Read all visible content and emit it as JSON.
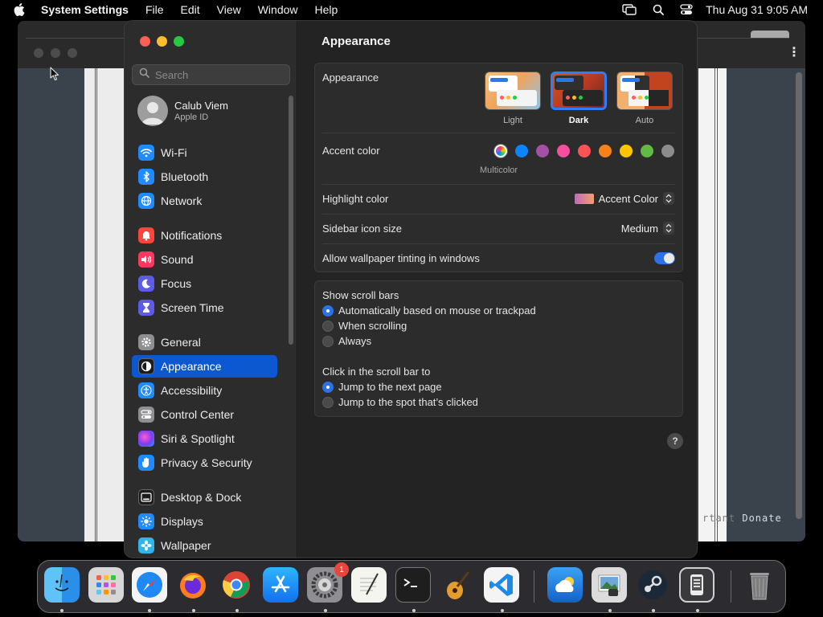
{
  "menubar": {
    "app_name": "System Settings",
    "items": [
      "File",
      "Edit",
      "View",
      "Window",
      "Help"
    ],
    "clock": "Thu Aug 31  9:05 AM",
    "status_icons": [
      "screen-mirroring-icon",
      "spotlight-search-icon",
      "control-center-icon"
    ]
  },
  "background_app": {
    "footer_text_faded": "rtant",
    "footer_text": " Donate"
  },
  "sidebar": {
    "search_placeholder": "Search",
    "account": {
      "name": "Calub Viem",
      "subtitle": "Apple ID"
    },
    "items": [
      {
        "label": "Wi-Fi",
        "icon": "wifi-icon",
        "color": "#1f8bff"
      },
      {
        "label": "Bluetooth",
        "icon": "bluetooth-icon",
        "color": "#1f8bff"
      },
      {
        "label": "Network",
        "icon": "globe-icon",
        "color": "#1f8bff"
      },
      {
        "label": "Notifications",
        "icon": "bell-icon",
        "color": "#ff453a"
      },
      {
        "label": "Sound",
        "icon": "speaker-icon",
        "color": "#ff375f"
      },
      {
        "label": "Focus",
        "icon": "moon-icon",
        "color": "#5e5ce6"
      },
      {
        "label": "Screen Time",
        "icon": "hourglass-icon",
        "color": "#5e5ce6"
      },
      {
        "label": "General",
        "icon": "gear-icon",
        "color": "#8e8e93"
      },
      {
        "label": "Appearance",
        "icon": "appearance-icon",
        "color": "#1c1c1e"
      },
      {
        "label": "Accessibility",
        "icon": "accessibility-icon",
        "color": "#1f8bff"
      },
      {
        "label": "Control Center",
        "icon": "control-center-icon",
        "color": "#8e8e93"
      },
      {
        "label": "Siri & Spotlight",
        "icon": "siri-icon",
        "color": "#b44cd6"
      },
      {
        "label": "Privacy & Security",
        "icon": "hand-icon",
        "color": "#1f8bff"
      },
      {
        "label": "Desktop & Dock",
        "icon": "dock-icon",
        "color": "#1c1c1e"
      },
      {
        "label": "Displays",
        "icon": "sun-icon",
        "color": "#1f8bff"
      },
      {
        "label": "Wallpaper",
        "icon": "flower-icon",
        "color": "#2fb5e8"
      }
    ],
    "active": "Appearance"
  },
  "content": {
    "title": "Appearance",
    "appearance": {
      "label": "Appearance",
      "options": [
        "Light",
        "Dark",
        "Auto"
      ],
      "selected": "Dark"
    },
    "accent": {
      "label": "Accent color",
      "colors": [
        "#ff0000",
        "#0a84ff",
        "#a550a7",
        "#f74f9e",
        "#ff5257",
        "#f7821b",
        "#ffc600",
        "#62ba46",
        "#8c8c8c"
      ],
      "selected_caption": "Multicolor"
    },
    "highlight": {
      "label": "Highlight color",
      "value": "Accent Color"
    },
    "sidebar_icon": {
      "label": "Sidebar icon size",
      "value": "Medium"
    },
    "tinting": {
      "label": "Allow wallpaper tinting in windows",
      "enabled": true
    },
    "scroll_bars": {
      "label": "Show scroll bars",
      "options": [
        "Automatically based on mouse or trackpad",
        "When scrolling",
        "Always"
      ],
      "selected": 0
    },
    "click_scroll": {
      "label": "Click in the scroll bar to",
      "options": [
        "Jump to the next page",
        "Jump to the spot that’s clicked"
      ],
      "selected": 0
    },
    "help": "?"
  },
  "dock": {
    "apps": [
      "Finder",
      "Launchpad",
      "Safari",
      "Firefox",
      "Chrome",
      "App Store",
      "System Settings",
      "TextEdit",
      "Terminal",
      "GarageBand",
      "VS Code",
      "Weather",
      "Preview",
      "Steam",
      "Simulator",
      "Trash"
    ],
    "badge": "1"
  }
}
